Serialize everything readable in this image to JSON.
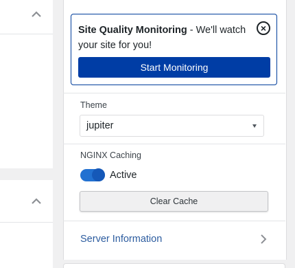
{
  "left_panel": {
    "top_section": {
      "caret_icon": "chevron-up-icon"
    },
    "bottom_section": {
      "caret_icon": "chevron-up-icon"
    }
  },
  "site_quality": {
    "title": "Site Quality Monitoring",
    "message": " - We'll watch your site for you!",
    "close_icon": "close-circle-icon",
    "button_label": "Start Monitoring"
  },
  "theme": {
    "label": "Theme",
    "selected": "jupiter"
  },
  "nginx": {
    "label": "NGINX Caching",
    "toggle_state": "Active",
    "clear_button": "Clear Cache"
  },
  "server_info": {
    "label": "Server Information",
    "icon": "chevron-right-icon"
  },
  "colors": {
    "primary_button": "#003da5",
    "toggle_on": "#2271d1",
    "link": "#2c5c9f",
    "background": "#f0f0f1"
  }
}
